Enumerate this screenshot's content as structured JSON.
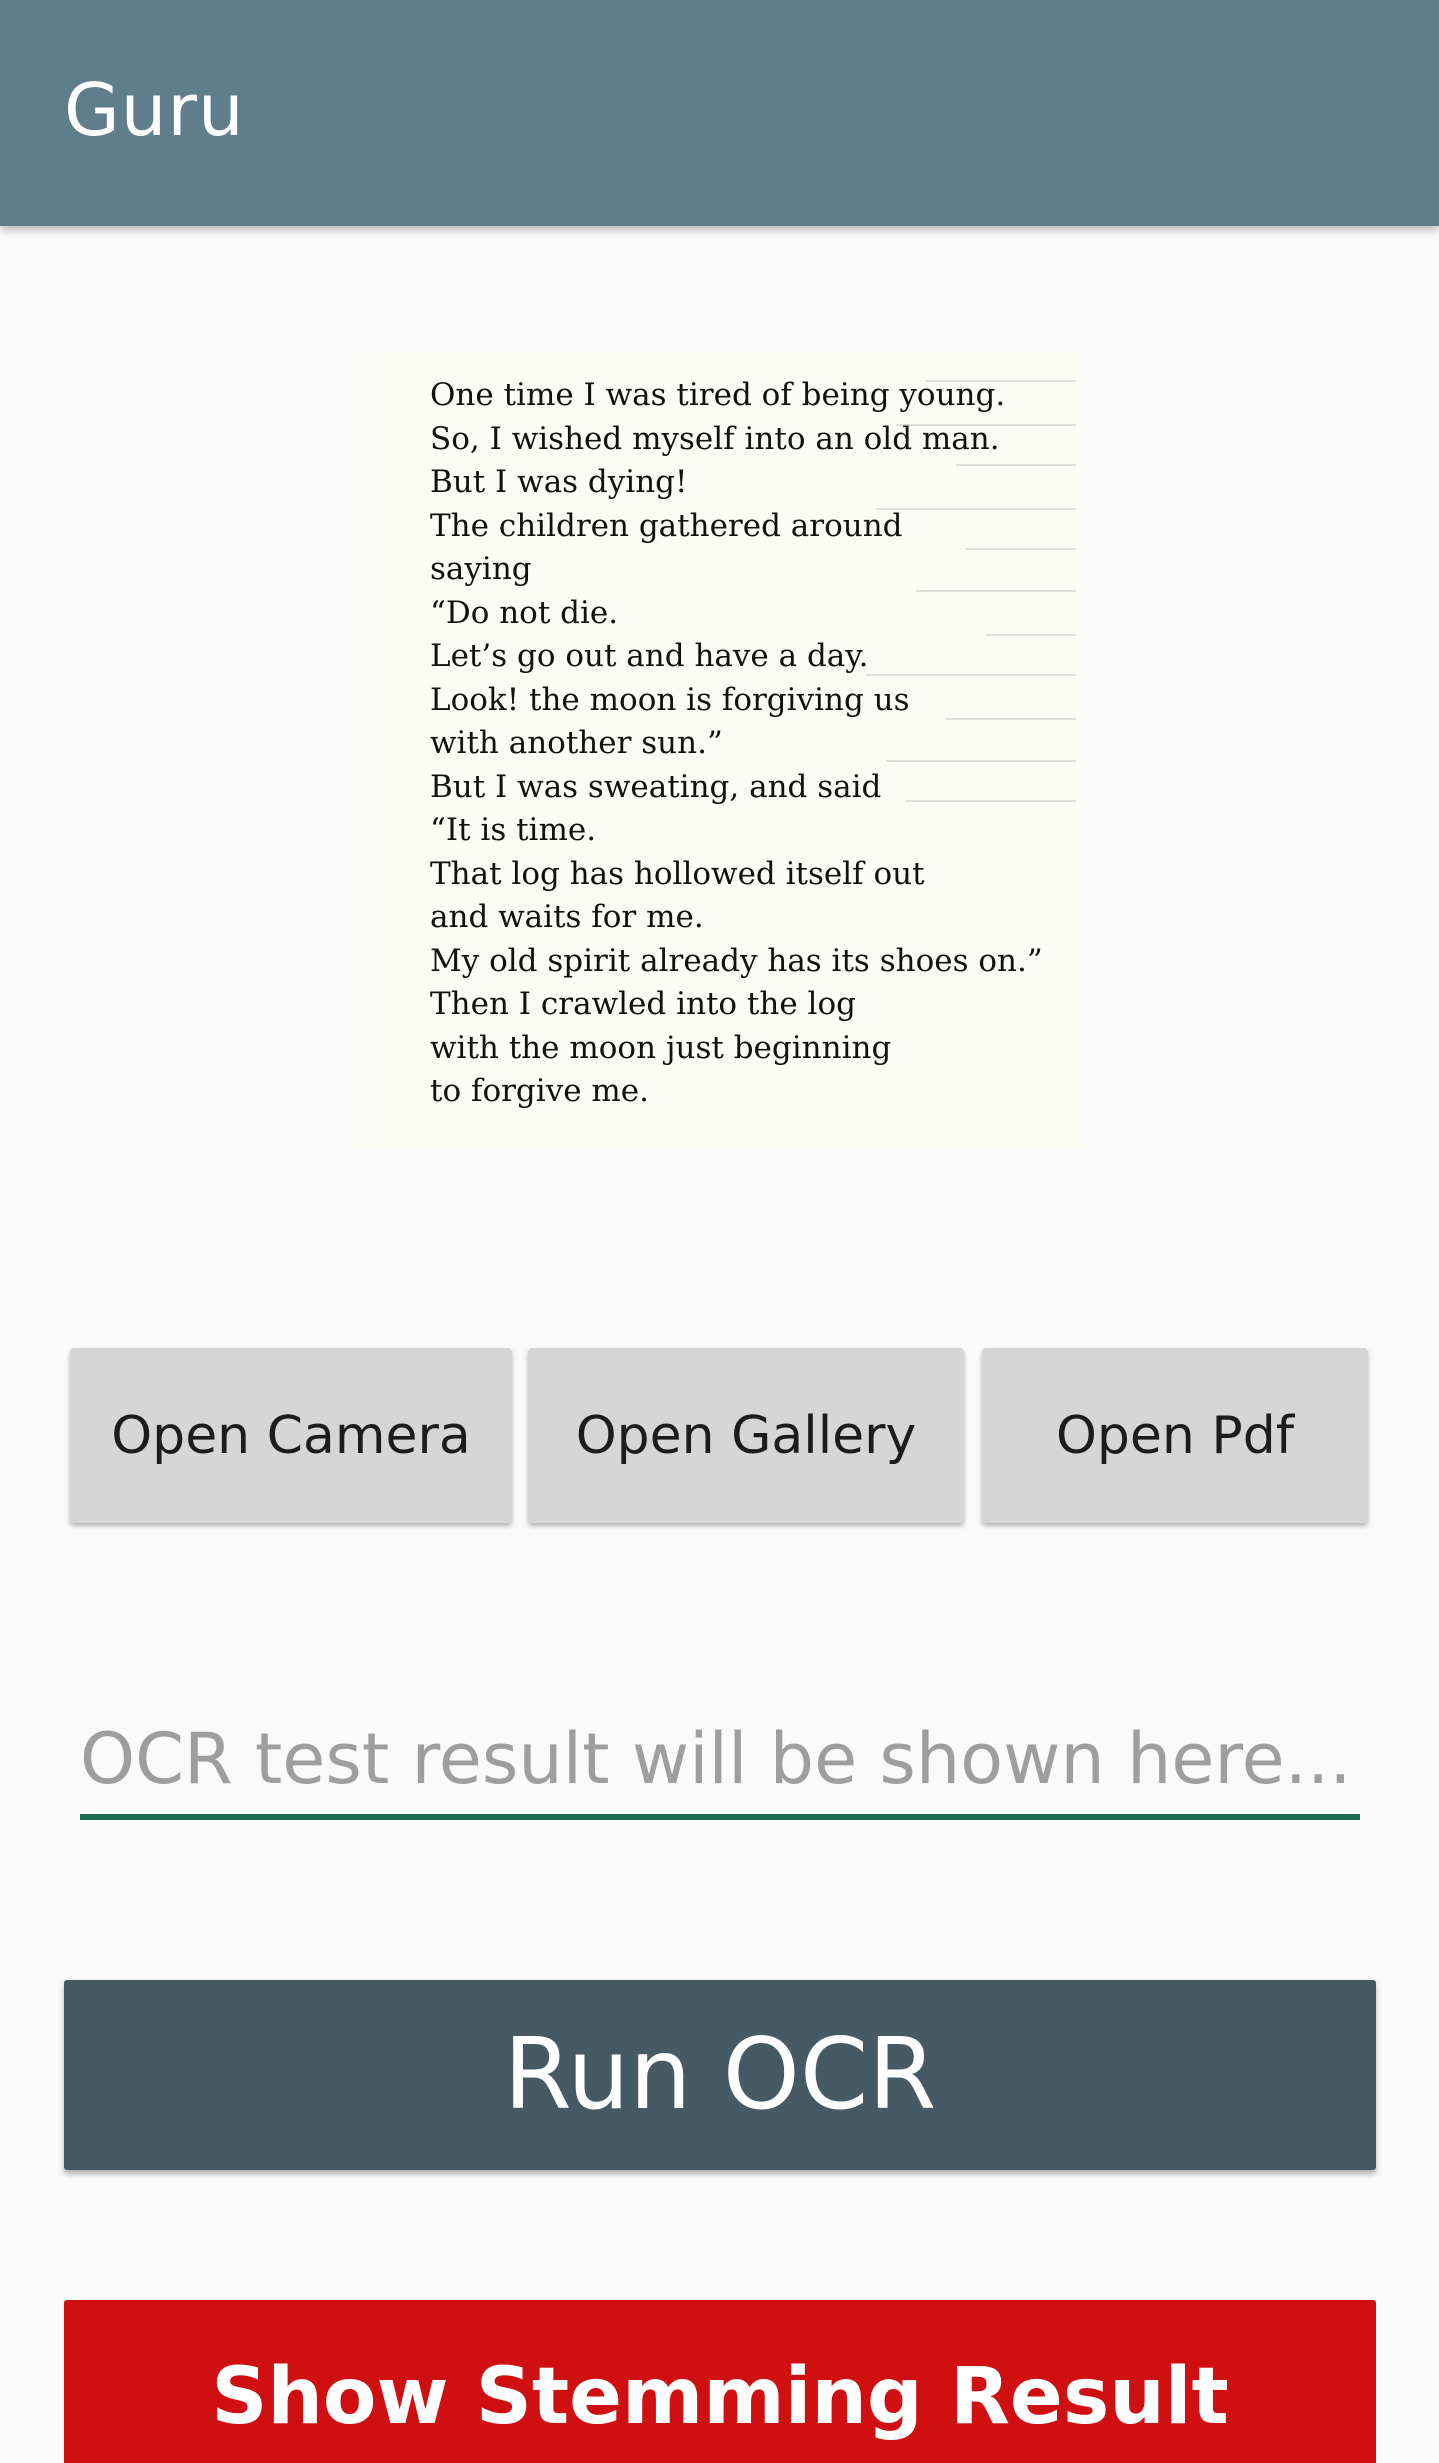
{
  "app_bar": {
    "title": "Guru",
    "color": "#607d8b"
  },
  "preview": {
    "lines": [
      "One time I was tired of being young.",
      "So, I wished myself into an old man.",
      "But I was dying!",
      "The children gathered around",
      "saying",
      "“Do not die.",
      "Let’s go out and have a day.",
      "Look! the moon is forgiving us",
      "with another sun.”",
      "But I was sweating, and said",
      "“It is time.",
      "That log has hollowed itself out",
      "and waits for me.",
      "My old spirit already has its shoes on.”",
      "Then I crawled into the log",
      "with the moon just beginning",
      "to forgive me."
    ]
  },
  "buttons": {
    "open_camera": "Open Camera",
    "open_gallery": "Open Gallery",
    "open_pdf": "Open Pdf"
  },
  "ocr_field": {
    "placeholder": "OCR test result will be shown here...",
    "value": "",
    "underline_color": "#1b6b4f"
  },
  "run_ocr": {
    "label": "Run OCR",
    "color": "#455a64"
  },
  "stemming": {
    "label": "Show Stemming Result",
    "color": "#d00f10"
  }
}
